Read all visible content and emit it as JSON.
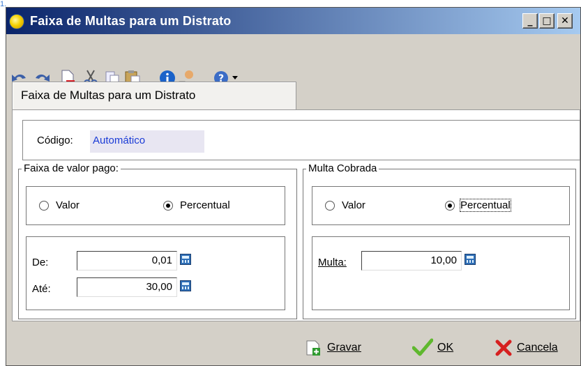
{
  "corner_mark": "1.",
  "window": {
    "title": "Faixa de Multas para um Distrato"
  },
  "tab": {
    "label": "Faixa de Multas para um Distrato"
  },
  "codigo": {
    "label": "Código:",
    "value": "Automático"
  },
  "faixa": {
    "legend": "Faixa de valor pago:",
    "radio_valor": "Valor",
    "radio_percentual": "Percentual",
    "selected": "Percentual",
    "de_label": "De:",
    "de_value": "0,01",
    "ate_label": "Até:",
    "ate_value": "30,00"
  },
  "multa": {
    "legend": "Multa Cobrada",
    "radio_valor": "Valor",
    "radio_percentual": "Percentual",
    "selected": "Percentual",
    "multa_label": "Multa:",
    "multa_value": "10,00"
  },
  "buttons": {
    "gravar": "Gravar",
    "ok": "OK",
    "cancela": "Cancela"
  },
  "colors": {
    "titlebar": "#0a246a",
    "window": "#d4d0c8",
    "accent_text": "#1a3bd6"
  }
}
